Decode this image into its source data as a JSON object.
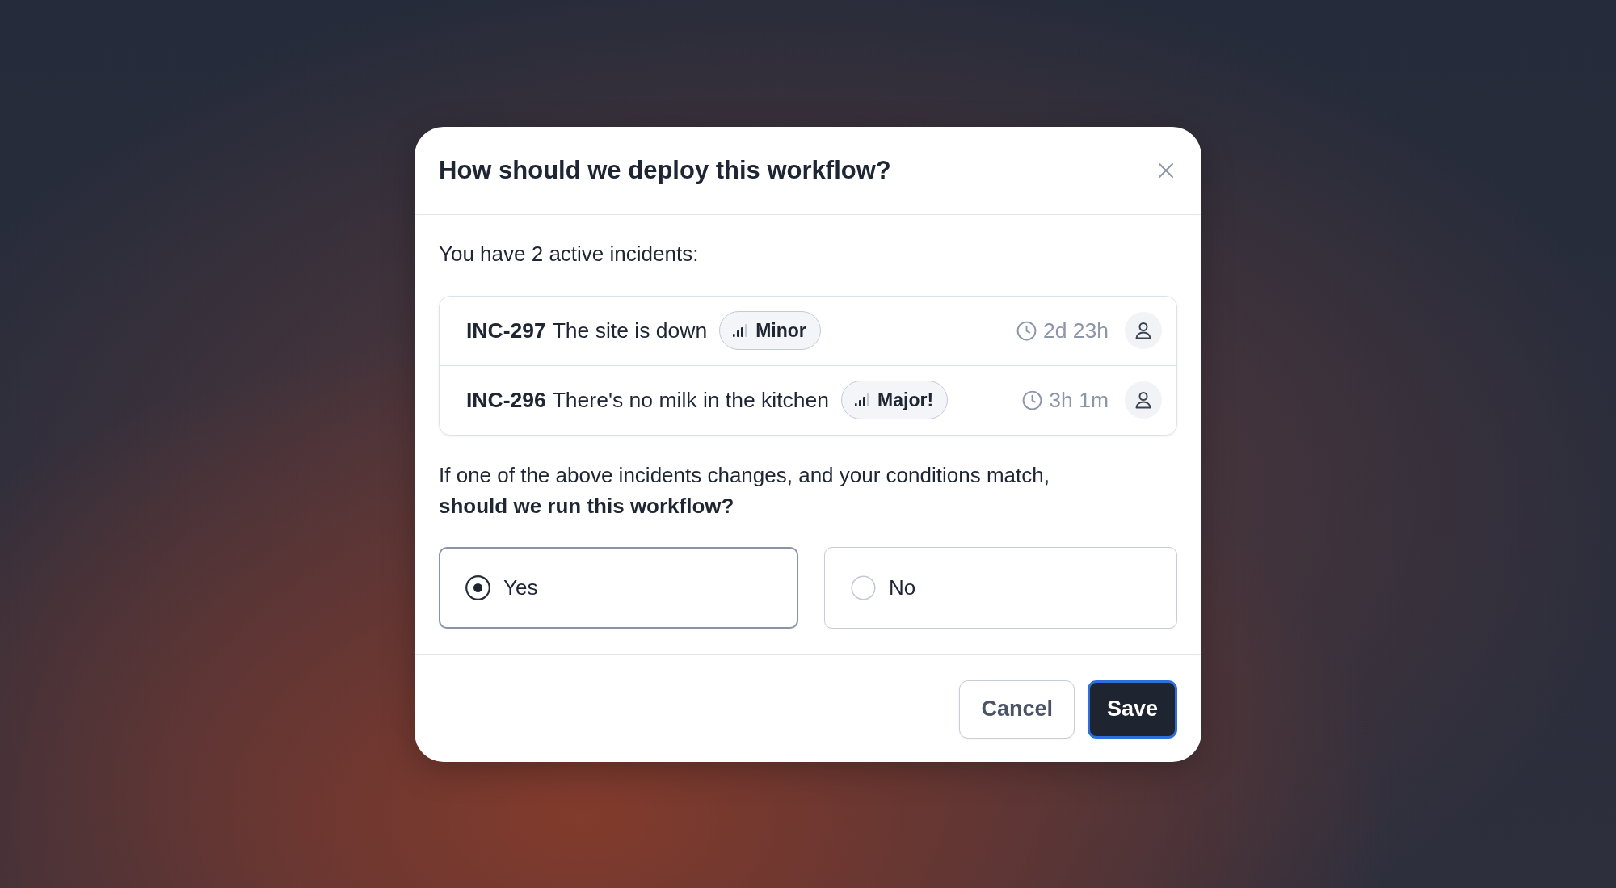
{
  "dialog": {
    "title": "How should we deploy this workflow?"
  },
  "intro": "You have 2 active incidents:",
  "incidents": [
    {
      "id": "INC-297",
      "title": "The site is down",
      "severity": "Minor",
      "duration": "2d 23h"
    },
    {
      "id": "INC-296",
      "title": "There's no milk in the kitchen",
      "severity": "Major!",
      "duration": "3h 1m"
    }
  ],
  "question": "If one of the above incidents changes, and your conditions match, **should we run this workflow?**",
  "options": [
    {
      "label": "Yes",
      "selected": true
    },
    {
      "label": "No",
      "selected": false
    }
  ],
  "buttons": [
    {
      "label": "Cancel",
      "kind": "secondary",
      "focused": false
    },
    {
      "label": "Save",
      "kind": "primary",
      "focused": true
    }
  ]
}
